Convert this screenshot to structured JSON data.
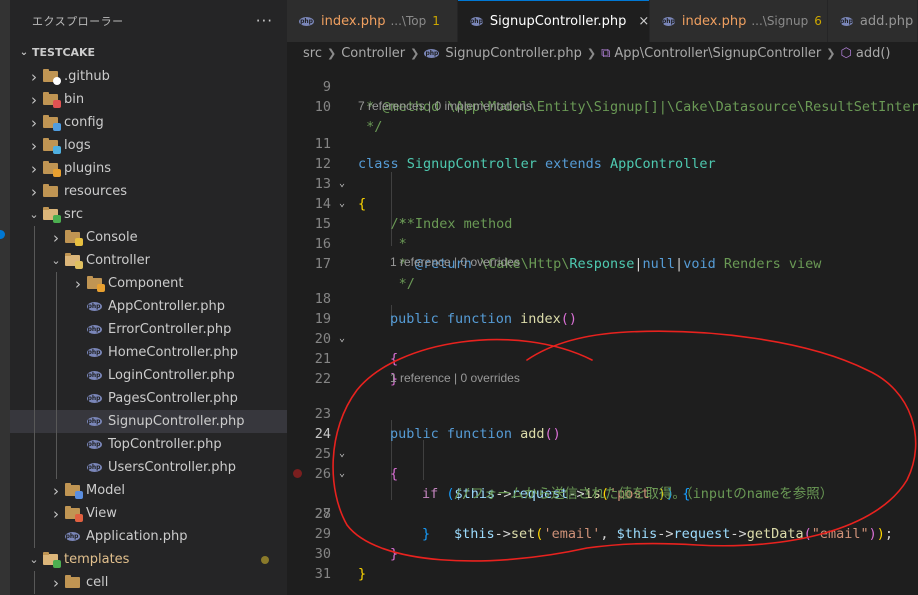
{
  "explorer": {
    "title": "エクスプローラー",
    "more": "···",
    "root": "TESTCAKE",
    "items": [
      {
        "label": ".github",
        "icon": "github-folder-icon",
        "depth": 0,
        "expanded": false
      },
      {
        "label": "bin",
        "icon": "bin-folder-icon",
        "depth": 0,
        "expanded": false
      },
      {
        "label": "config",
        "icon": "config-folder-icon",
        "depth": 0,
        "expanded": false
      },
      {
        "label": "logs",
        "icon": "logs-folder-icon",
        "depth": 0,
        "expanded": false
      },
      {
        "label": "plugins",
        "icon": "plugins-folder-icon",
        "depth": 0,
        "expanded": false
      },
      {
        "label": "resources",
        "icon": "folder-icon",
        "depth": 0,
        "expanded": false
      },
      {
        "label": "src",
        "icon": "src-folder-icon",
        "depth": 0,
        "expanded": true
      },
      {
        "label": "Console",
        "icon": "console-folder-icon",
        "depth": 1,
        "expanded": false
      },
      {
        "label": "Controller",
        "icon": "controller-folder-icon",
        "depth": 1,
        "expanded": true
      },
      {
        "label": "Component",
        "icon": "component-folder-icon",
        "depth": 2,
        "expanded": false
      },
      {
        "label": "AppController.php",
        "icon": "php-file-icon",
        "depth": 2
      },
      {
        "label": "ErrorController.php",
        "icon": "php-file-icon",
        "depth": 2
      },
      {
        "label": "HomeController.php",
        "icon": "php-file-icon",
        "depth": 2
      },
      {
        "label": "LoginController.php",
        "icon": "php-file-icon",
        "depth": 2
      },
      {
        "label": "PagesController.php",
        "icon": "php-file-icon",
        "depth": 2
      },
      {
        "label": "SignupController.php",
        "icon": "php-file-icon",
        "depth": 2,
        "selected": true
      },
      {
        "label": "TopController.php",
        "icon": "php-file-icon",
        "depth": 2
      },
      {
        "label": "UsersController.php",
        "icon": "php-file-icon",
        "depth": 2
      },
      {
        "label": "Model",
        "icon": "model-folder-icon",
        "depth": 1,
        "expanded": false
      },
      {
        "label": "View",
        "icon": "view-folder-icon",
        "depth": 1,
        "expanded": false
      },
      {
        "label": "Application.php",
        "icon": "php-file-icon",
        "depth": 1
      },
      {
        "label": "templates",
        "icon": "templates-folder-icon",
        "depth": 0,
        "expanded": true,
        "modified": true
      },
      {
        "label": "cell",
        "icon": "folder-icon",
        "depth": 1,
        "expanded": false
      }
    ]
  },
  "tabs": [
    {
      "name": "index.php",
      "desc": "...\\Top",
      "count": "1",
      "active": false,
      "error": true
    },
    {
      "name": "SignupController.php",
      "active": true,
      "close": "×"
    },
    {
      "name": "index.php",
      "desc": "...\\Signup",
      "count": "6",
      "active": false,
      "error": true
    },
    {
      "name": "add.php",
      "active": false
    }
  ],
  "breadcrumb": {
    "parts": [
      "src",
      "Controller",
      "SignupController.php",
      "App\\Controller\\SignupController",
      "add()"
    ]
  },
  "editor": {
    "current_line": "24",
    "lenses": {
      "class": "7 references | 0 implementations",
      "index": "1 reference | 0 overrides",
      "add": "1 reference | 0 overrides"
    },
    "line_numbers": [
      "9",
      "10",
      "11",
      "12",
      "13",
      "14",
      "15",
      "16",
      "17",
      "18",
      "19",
      "20",
      "21",
      "22",
      "23",
      "24",
      "25",
      "26",
      "27",
      "28",
      "29",
      "30",
      "31"
    ],
    "code": {
      "l9": " * @method \\App\\Model\\Entity\\Signup[]|\\Cake\\Datasource\\ResultSetInterface paginate($object = null, array $settings = [])",
      "l10": " */",
      "l11a": "class",
      "l11b": "SignupController",
      "l11c": "extends",
      "l11d": "AppController",
      "l12": "{",
      "l13": "    /**",
      "l14": "     * Index method",
      "l15": "     *",
      "l16a": "     * ",
      "l16b": "@return",
      "l16c": "\\Cake\\Http\\",
      "l16d": "Response",
      "l16e": "|",
      "l16f": "null",
      "l16g": "|",
      "l16h": "void",
      "l16i": " Renders view",
      "l17": "     */",
      "l18a": "public",
      "l18b": "function",
      "l18c": "index",
      "l18d": "()",
      "l19": "{",
      "l21": "}",
      "l23a": "public",
      "l23b": "function",
      "l23c": "add",
      "l23d": "()",
      "l24": "{",
      "l25a": "if",
      "l25b": "(",
      "l25c": "$this",
      "l25d": "->",
      "l25e": "request",
      "l25f": "->",
      "l25g": "is",
      "l25h": "(",
      "l25i": "'post'",
      "l25j": ")",
      "l25k": ")",
      "l25l": "{",
      "l26": "//フォームから送信された値を取得。（inputのnameを参照）",
      "l27a": "$this",
      "l27b": "->",
      "l27c": "set",
      "l27d": "(",
      "l27e": "'email'",
      "l27f": ", ",
      "l27g": "$this",
      "l27h": "->",
      "l27i": "request",
      "l27j": "->",
      "l27k": "getData",
      "l27l": "(",
      "l27m": "\"email\"",
      "l27n": ")",
      "l27o": ")",
      "l27p": ";",
      "l28": "}",
      "l29": "}",
      "l30": "}"
    }
  },
  "colors": {
    "annotation_circle": "#e8221e",
    "accent": "#0078d4"
  }
}
